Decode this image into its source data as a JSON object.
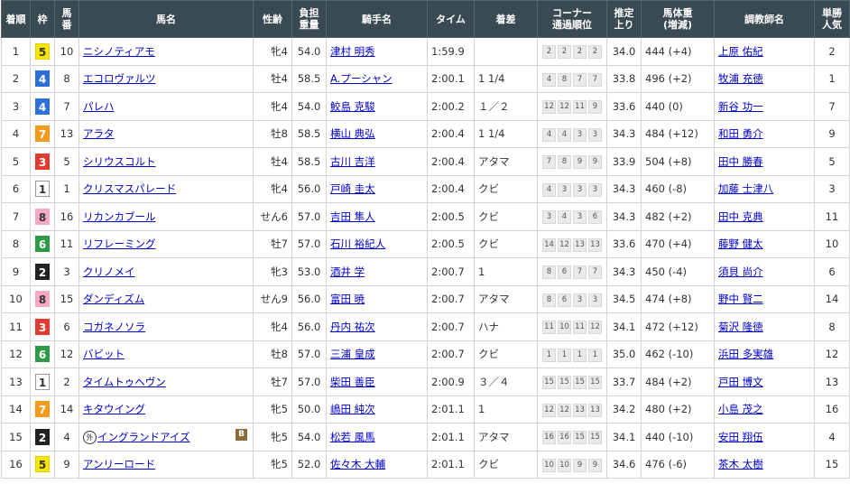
{
  "headers": [
    "着順",
    "枠",
    "馬\n番",
    "馬名",
    "性齢",
    "負担\n重量",
    "騎手名",
    "タイム",
    "着差",
    "コーナー\n通過順位",
    "推定\n上り",
    "馬体重\n(増減)",
    "調教師名",
    "単勝\n人気"
  ],
  "waku_colors": {
    "1": {
      "bg": "#ffffff",
      "fg": "#333333",
      "border": "#999999"
    },
    "2": {
      "bg": "#222222",
      "fg": "#ffffff",
      "border": "#222222"
    },
    "3": {
      "bg": "#e03c31",
      "fg": "#ffffff",
      "border": "#e03c31"
    },
    "4": {
      "bg": "#2e6fd8",
      "fg": "#ffffff",
      "border": "#2e6fd8"
    },
    "5": {
      "bg": "#f5e500",
      "fg": "#333333",
      "border": "#e0d000"
    },
    "6": {
      "bg": "#2e9a47",
      "fg": "#ffffff",
      "border": "#2e9a47"
    },
    "7": {
      "bg": "#f29b1d",
      "fg": "#ffffff",
      "border": "#f29b1d"
    },
    "8": {
      "bg": "#f7a8c4",
      "fg": "#333333",
      "border": "#f7a8c4"
    }
  },
  "rows": [
    {
      "rank": "1",
      "waku": "5",
      "umaban": "10",
      "horse": "ニシノティアモ",
      "sexage": "牝4",
      "weight": "54.0",
      "jockey": "津村 明秀",
      "time": "1:59.9",
      "margin": "",
      "corners": [
        "2",
        "2",
        "2",
        "2"
      ],
      "agari": "34.0",
      "body": "444 (+4)",
      "trainer": "上原 佑紀",
      "pop": "2"
    },
    {
      "rank": "2",
      "waku": "4",
      "umaban": "8",
      "horse": "エコロヴァルツ",
      "sexage": "牡4",
      "weight": "58.5",
      "jockey": "A.プーシャン",
      "time": "2:00.1",
      "margin": "1 1/4",
      "corners": [
        "4",
        "8",
        "7",
        "7"
      ],
      "agari": "33.8",
      "body": "496 (+2)",
      "trainer": "牧浦 充徳",
      "pop": "1"
    },
    {
      "rank": "3",
      "waku": "4",
      "umaban": "7",
      "horse": "パレハ",
      "sexage": "牝4",
      "weight": "54.0",
      "jockey": "鮫島 克駿",
      "time": "2:00.2",
      "margin": "１／２",
      "corners": [
        "12",
        "12",
        "11",
        "9"
      ],
      "agari": "33.6",
      "body": "440 (0)",
      "trainer": "新谷 功一",
      "pop": "7"
    },
    {
      "rank": "4",
      "waku": "7",
      "umaban": "13",
      "horse": "アラタ",
      "sexage": "牡8",
      "weight": "58.5",
      "jockey": "横山 典弘",
      "time": "2:00.4",
      "margin": "1 1/4",
      "corners": [
        "4",
        "4",
        "3",
        "3"
      ],
      "agari": "34.3",
      "body": "484 (+12)",
      "trainer": "和田 勇介",
      "pop": "9"
    },
    {
      "rank": "5",
      "waku": "3",
      "umaban": "5",
      "horse": "シリウスコルト",
      "sexage": "牡4",
      "weight": "58.5",
      "jockey": "古川 吉洋",
      "time": "2:00.4",
      "margin": "アタマ",
      "corners": [
        "7",
        "8",
        "9",
        "9"
      ],
      "agari": "33.9",
      "body": "504 (+8)",
      "trainer": "田中 勝春",
      "pop": "5"
    },
    {
      "rank": "6",
      "waku": "1",
      "umaban": "1",
      "horse": "クリスマスパレード",
      "sexage": "牝4",
      "weight": "56.0",
      "jockey": "戸崎 圭太",
      "time": "2:00.4",
      "margin": "クビ",
      "corners": [
        "4",
        "3",
        "3",
        "3"
      ],
      "agari": "34.3",
      "body": "460 (-8)",
      "trainer": "加藤 士津八",
      "pop": "3"
    },
    {
      "rank": "7",
      "waku": "8",
      "umaban": "16",
      "horse": "リカンカブール",
      "sexage": "せん6",
      "weight": "57.0",
      "jockey": "吉田 隼人",
      "time": "2:00.5",
      "margin": "クビ",
      "corners": [
        "3",
        "4",
        "3",
        "6"
      ],
      "agari": "34.3",
      "body": "482 (+2)",
      "trainer": "田中 克典",
      "pop": "11"
    },
    {
      "rank": "8",
      "waku": "6",
      "umaban": "11",
      "horse": "リフレーミング",
      "sexage": "牡7",
      "weight": "57.0",
      "jockey": "石川 裕紀人",
      "time": "2:00.5",
      "margin": "クビ",
      "corners": [
        "14",
        "12",
        "13",
        "13"
      ],
      "agari": "33.6",
      "body": "470 (+4)",
      "trainer": "藤野 健太",
      "pop": "10"
    },
    {
      "rank": "9",
      "waku": "2",
      "umaban": "3",
      "horse": "クリノメイ",
      "sexage": "牝3",
      "weight": "53.0",
      "jockey": "酒井 学",
      "time": "2:00.7",
      "margin": "1",
      "corners": [
        "8",
        "6",
        "7",
        "7"
      ],
      "agari": "34.3",
      "body": "450 (-4)",
      "trainer": "須貝 尚介",
      "pop": "6"
    },
    {
      "rank": "10",
      "waku": "8",
      "umaban": "15",
      "horse": "ダンディズム",
      "sexage": "せん9",
      "weight": "56.0",
      "jockey": "富田 暁",
      "time": "2:00.7",
      "margin": "アタマ",
      "corners": [
        "8",
        "6",
        "3",
        "3"
      ],
      "agari": "34.5",
      "body": "474 (+8)",
      "trainer": "野中 賢二",
      "pop": "14"
    },
    {
      "rank": "11",
      "waku": "3",
      "umaban": "6",
      "horse": "コガネノソラ",
      "sexage": "牝4",
      "weight": "56.0",
      "jockey": "丹内 祐次",
      "time": "2:00.7",
      "margin": "ハナ",
      "corners": [
        "11",
        "10",
        "11",
        "12"
      ],
      "agari": "34.1",
      "body": "472 (+12)",
      "trainer": "菊沢 隆徳",
      "pop": "8"
    },
    {
      "rank": "12",
      "waku": "6",
      "umaban": "12",
      "horse": "バビット",
      "sexage": "牡8",
      "weight": "57.0",
      "jockey": "三浦 皇成",
      "time": "2:00.7",
      "margin": "クビ",
      "corners": [
        "1",
        "1",
        "1",
        "1"
      ],
      "agari": "35.0",
      "body": "462 (-10)",
      "trainer": "浜田 多実雄",
      "pop": "12"
    },
    {
      "rank": "13",
      "waku": "1",
      "umaban": "2",
      "horse": "タイムトゥヘヴン",
      "sexage": "牡7",
      "weight": "57.0",
      "jockey": "柴田 善臣",
      "time": "2:00.9",
      "margin": "３／４",
      "corners": [
        "15",
        "15",
        "15",
        "15"
      ],
      "agari": "33.7",
      "body": "484 (+2)",
      "trainer": "戸田 博文",
      "pop": "13"
    },
    {
      "rank": "14",
      "waku": "7",
      "umaban": "14",
      "horse": "キタウイング",
      "sexage": "牝5",
      "weight": "50.0",
      "jockey": "嶋田 純次",
      "time": "2:01.1",
      "margin": "1",
      "corners": [
        "12",
        "12",
        "13",
        "13"
      ],
      "agari": "34.2",
      "body": "480 (+2)",
      "trainer": "小島 茂之",
      "pop": "16"
    },
    {
      "rank": "15",
      "waku": "2",
      "umaban": "4",
      "horse": "イングランドアイズ",
      "gai": "外",
      "blinker": "B",
      "sexage": "牝5",
      "weight": "54.0",
      "jockey": "松若 風馬",
      "time": "2:01.1",
      "margin": "アタマ",
      "corners": [
        "16",
        "16",
        "15",
        "15"
      ],
      "agari": "34.1",
      "body": "440 (-10)",
      "trainer": "安田 翔伍",
      "pop": "4"
    },
    {
      "rank": "16",
      "waku": "5",
      "umaban": "9",
      "horse": "アンリーロード",
      "sexage": "牝5",
      "weight": "52.0",
      "jockey": "佐々木 大輔",
      "time": "2:01.1",
      "margin": "クビ",
      "corners": [
        "10",
        "10",
        "9",
        "9"
      ],
      "agari": "34.6",
      "body": "476 (-6)",
      "trainer": "茶木 太樹",
      "pop": "15"
    }
  ]
}
